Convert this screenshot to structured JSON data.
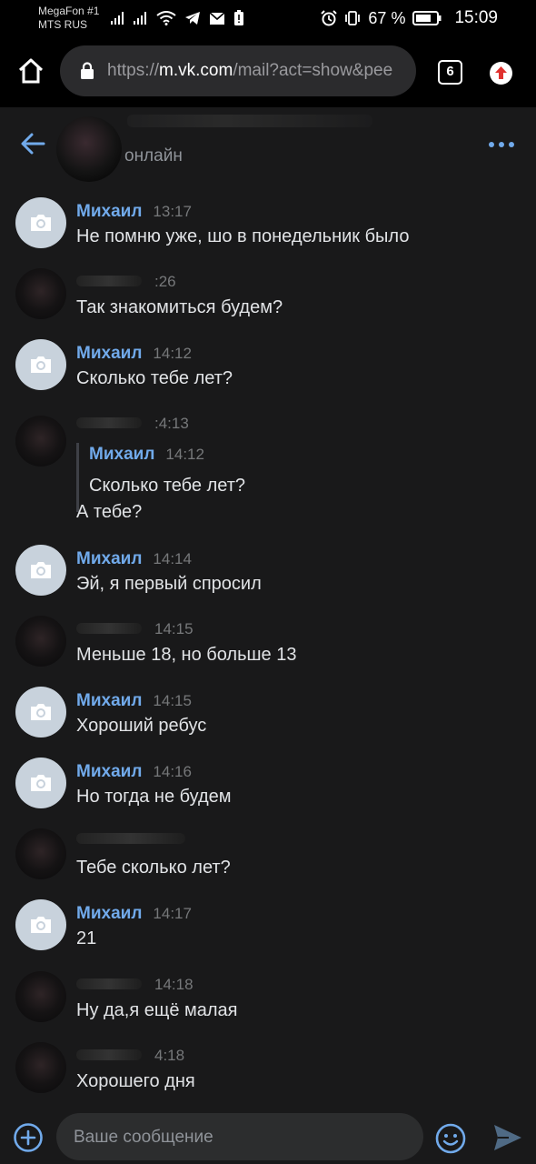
{
  "statusbar": {
    "carrier1": "MegaFon #1",
    "carrier2": "MTS RUS",
    "battery": "67 %",
    "clock": "15:09"
  },
  "browser": {
    "url_scheme": "https://",
    "url_host": "m.vk.com",
    "url_path": "/mail?act=show&pee",
    "tab_count": "6"
  },
  "header": {
    "status": "онлайн"
  },
  "messages": [
    {
      "author": "Михаил",
      "time": "13:17",
      "text": "Не помню уже, шо в понедельник было"
    },
    {
      "author": "",
      "time": ":26",
      "text": "Так знакомиться будем?"
    },
    {
      "author": "Михаил",
      "time": "14:12",
      "text": "Сколько тебе лет?"
    },
    {
      "author": "",
      "time": ":4:13",
      "text": "А тебе?",
      "quote": {
        "author": "Михаил",
        "time": "14:12",
        "text": "Сколько тебе лет?"
      }
    },
    {
      "author": "Михаил",
      "time": "14:14",
      "text": "Эй, я первый спросил"
    },
    {
      "author": "",
      "time": "14:15",
      "text": "Меньше 18, но больше 13"
    },
    {
      "author": "Михаил",
      "time": "14:15",
      "text": "Хороший ребус"
    },
    {
      "author": "Михаил",
      "time": "14:16",
      "text": "Но тогда не будем"
    },
    {
      "author": "",
      "time": "",
      "text": "Тебе сколько лет?"
    },
    {
      "author": "Михаил",
      "time": "14:17",
      "text": "21"
    },
    {
      "author": "",
      "time": "14:18",
      "text": "Ну да,я ещё малая"
    },
    {
      "author": "",
      "time": "4:18",
      "text": "Хорошего дня"
    }
  ],
  "composer": {
    "placeholder": "Ваше сообщение"
  },
  "colors": {
    "background": "#19191a",
    "accent": "#71aaeb",
    "text": "#e1e3e6",
    "muted": "#76787a"
  }
}
